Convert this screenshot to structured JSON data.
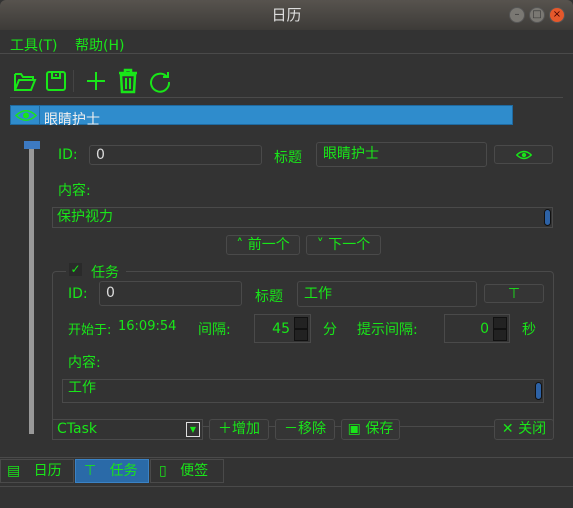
{
  "window": {
    "title": "日历"
  },
  "menu": [
    "工具(T)",
    "帮助(H)"
  ],
  "toolbar": {
    "icons": [
      "folder-open-icon",
      "save-icon",
      "plus-icon",
      "trash-icon",
      "refresh-icon"
    ]
  },
  "list": {
    "items": [
      {
        "label": "眼睛护士",
        "icon": "eye-icon",
        "selected": true
      }
    ]
  },
  "reminder": {
    "id_label": "ID:",
    "id": "0",
    "title_label": "标题",
    "title": "眼睛护士",
    "content_label": "内容:",
    "content": "保护视力",
    "prev": "前一个",
    "next": "下一个"
  },
  "task": {
    "group_label": "任务",
    "checked": true,
    "id_label": "ID:",
    "id": "0",
    "title_label": "标题",
    "title": "工作",
    "start_label": "开始于:",
    "start_time": "16:09:54",
    "interval_label": "间隔:",
    "interval": "45",
    "interval_unit": "分",
    "hint_label": "提示间隔:",
    "hint": "0",
    "hint_unit": "秒",
    "content_label": "内容:",
    "content": "工作"
  },
  "bottom": {
    "combo": "CTask",
    "add": "增加",
    "remove": "移除",
    "save": "保存",
    "close": "关闭"
  },
  "tabs": [
    {
      "label": "日历",
      "selected": false
    },
    {
      "label": "任务",
      "selected": true
    },
    {
      "label": "便签",
      "selected": false
    }
  ],
  "colors": {
    "text": "#19e619",
    "selection": "#2f8ccc",
    "bg": "#333333"
  }
}
